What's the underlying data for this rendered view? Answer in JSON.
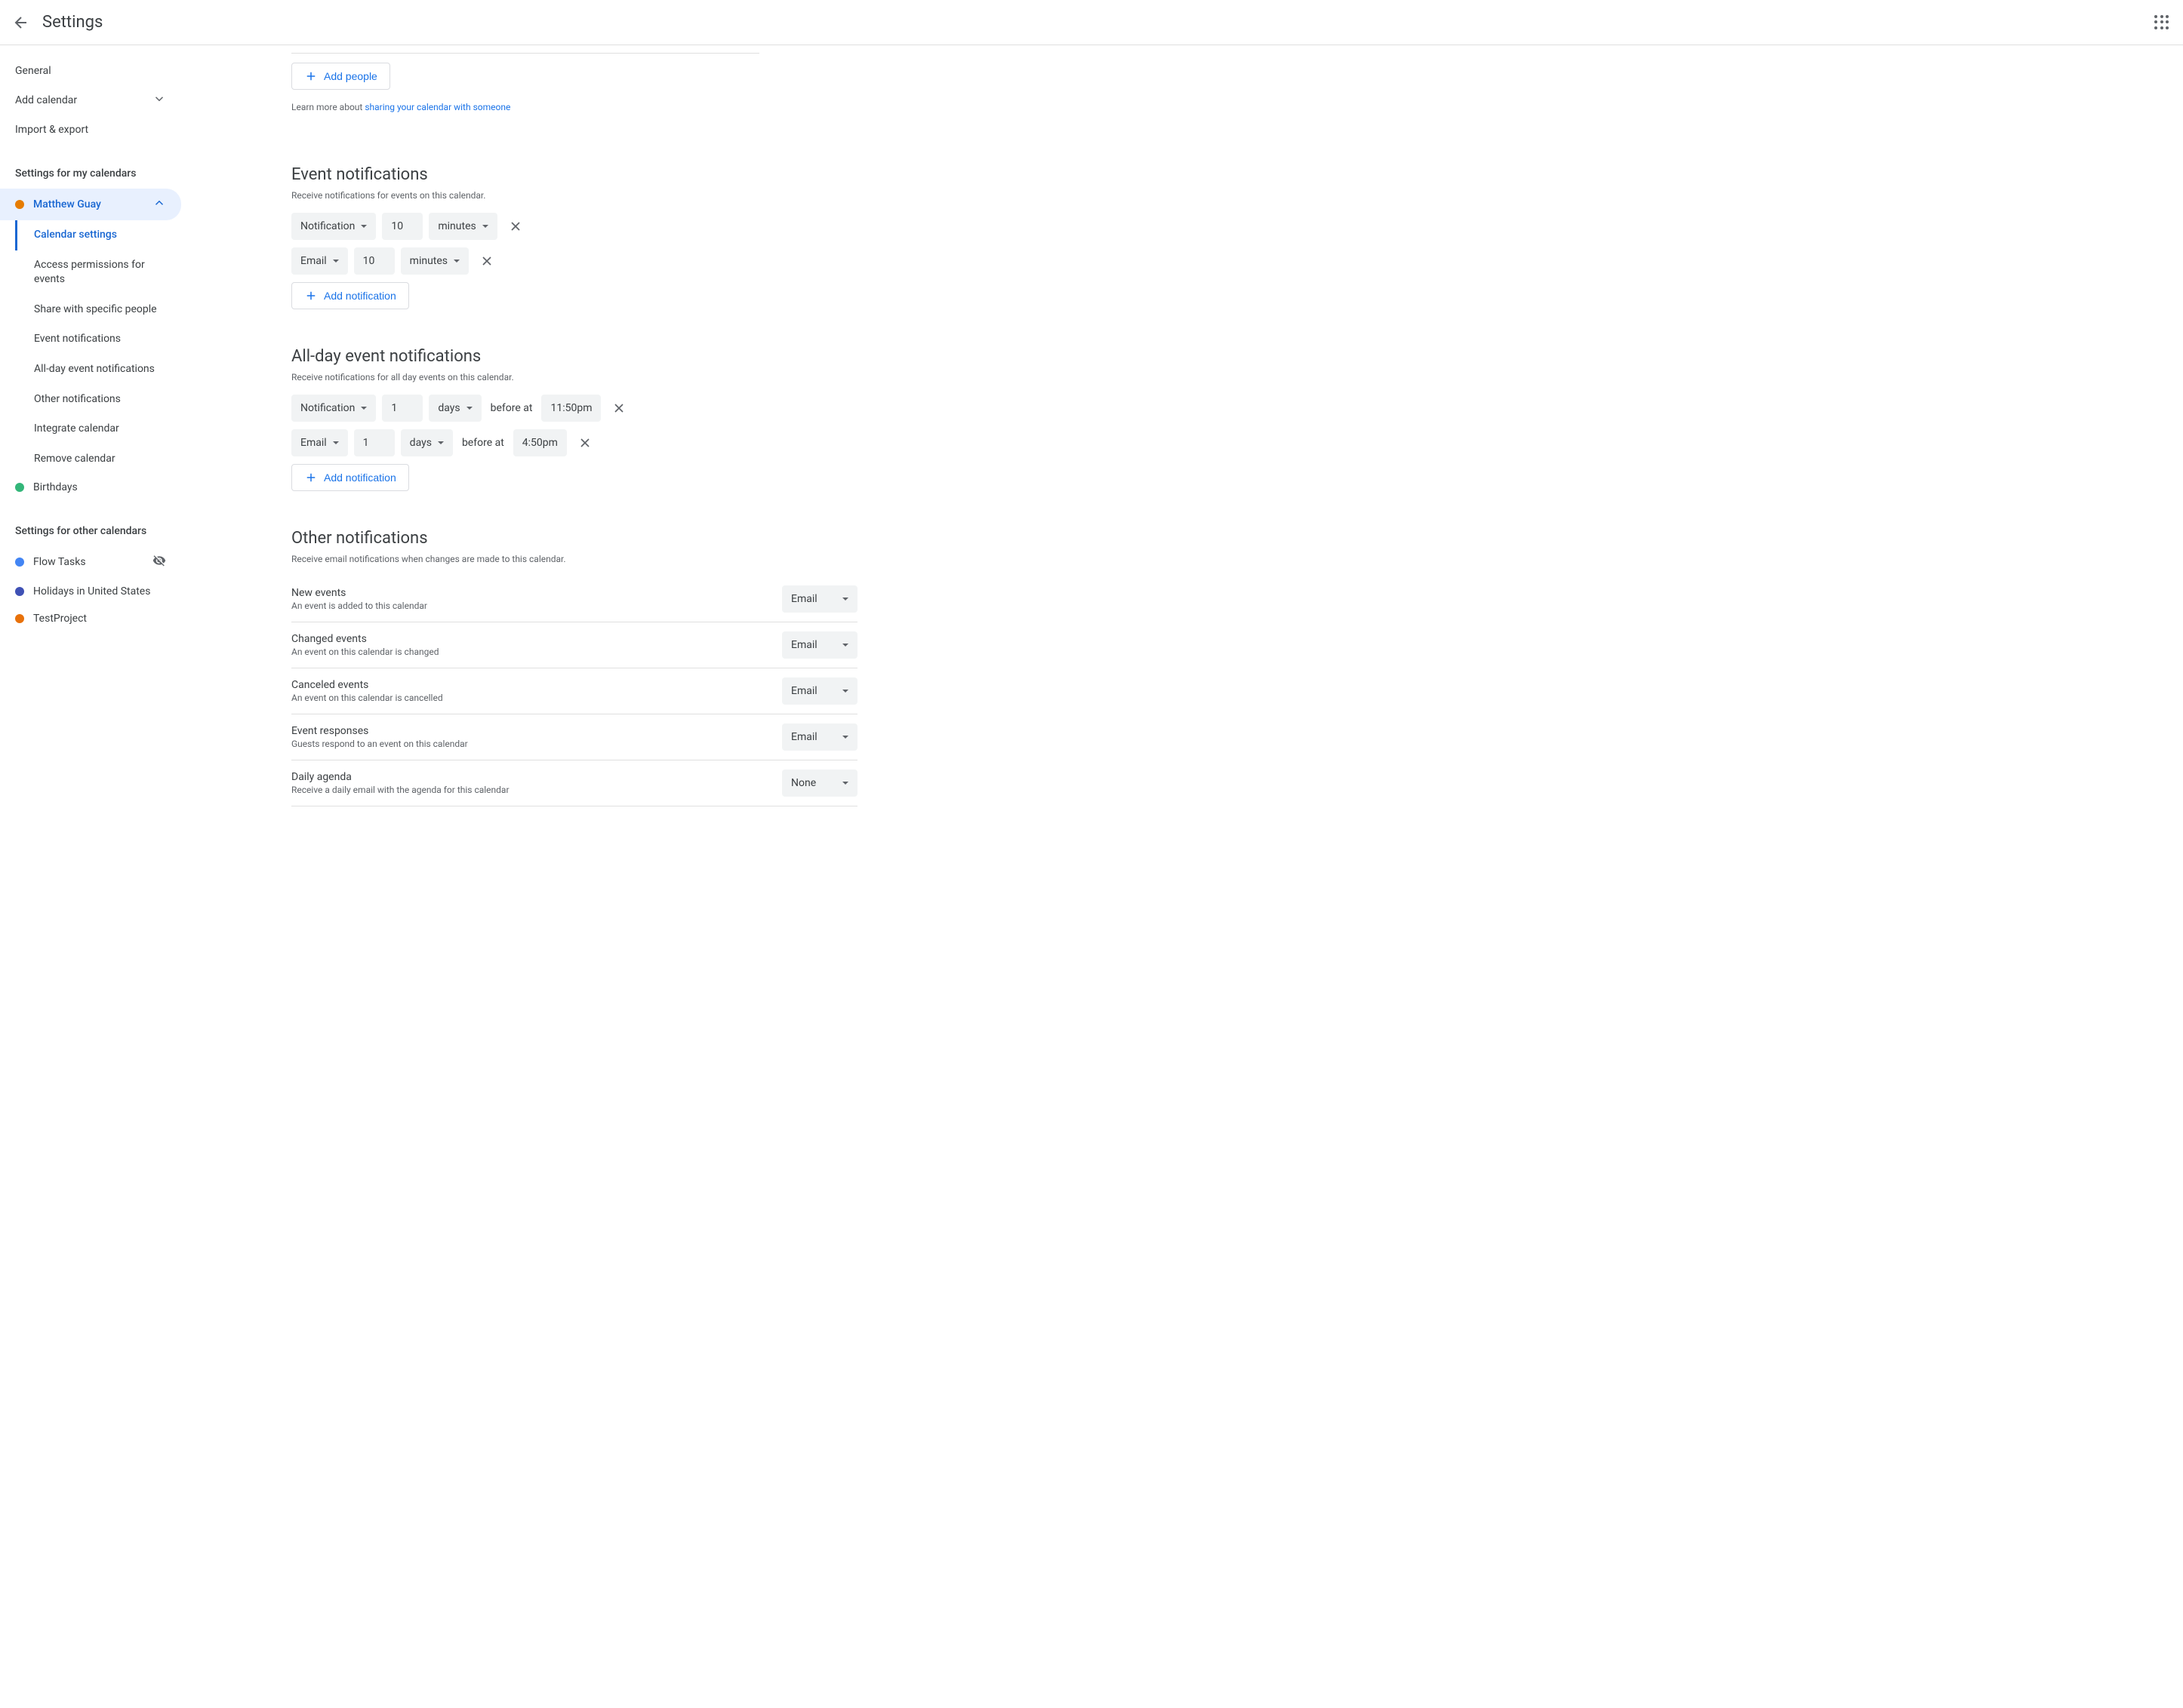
{
  "header": {
    "title": "Settings"
  },
  "sidebar": {
    "top": [
      {
        "label": "General"
      },
      {
        "label": "Add calendar",
        "expandable": true
      },
      {
        "label": "Import & export"
      }
    ],
    "myCalendarsHeader": "Settings for my calendars",
    "activeCalendar": {
      "name": "Matthew Guay",
      "color": "#e67c00"
    },
    "subnav": [
      "Calendar settings",
      "Access permissions for events",
      "Share with specific people",
      "Event notifications",
      "All-day event notifications",
      "Other notifications",
      "Integrate calendar",
      "Remove calendar"
    ],
    "birthdays": {
      "name": "Birthdays",
      "color": "#33b679"
    },
    "otherCalendarsHeader": "Settings for other calendars",
    "otherCalendars": [
      {
        "name": "Flow Tasks",
        "color": "#4285f4",
        "hidden": true
      },
      {
        "name": "Holidays in United States",
        "color": "#3f51b5"
      },
      {
        "name": "TestProject",
        "color": "#e8710a"
      }
    ]
  },
  "share": {
    "addPeople": "Add people",
    "learnMorePrefix": "Learn more about ",
    "learnMoreLink": "sharing your calendar with someone"
  },
  "eventNotifications": {
    "title": "Event notifications",
    "desc": "Receive notifications for events on this calendar.",
    "rows": [
      {
        "type": "Notification",
        "amount": "10",
        "unit": "minutes"
      },
      {
        "type": "Email",
        "amount": "10",
        "unit": "minutes"
      }
    ],
    "addBtn": "Add notification"
  },
  "allDayNotifications": {
    "title": "All-day event notifications",
    "desc": "Receive notifications for all day events on this calendar.",
    "beforeAt": "before at",
    "rows": [
      {
        "type": "Notification",
        "amount": "1",
        "unit": "days",
        "time": "11:50pm"
      },
      {
        "type": "Email",
        "amount": "1",
        "unit": "days",
        "time": "4:50pm"
      }
    ],
    "addBtn": "Add notification"
  },
  "otherNotifications": {
    "title": "Other notifications",
    "desc": "Receive email notifications when changes are made to this calendar.",
    "items": [
      {
        "title": "New events",
        "desc": "An event is added to this calendar",
        "value": "Email"
      },
      {
        "title": "Changed events",
        "desc": "An event on this calendar is changed",
        "value": "Email"
      },
      {
        "title": "Canceled events",
        "desc": "An event on this calendar is cancelled",
        "value": "Email"
      },
      {
        "title": "Event responses",
        "desc": "Guests respond to an event on this calendar",
        "value": "Email"
      },
      {
        "title": "Daily agenda",
        "desc": "Receive a daily email with the agenda for this calendar",
        "value": "None"
      }
    ]
  }
}
